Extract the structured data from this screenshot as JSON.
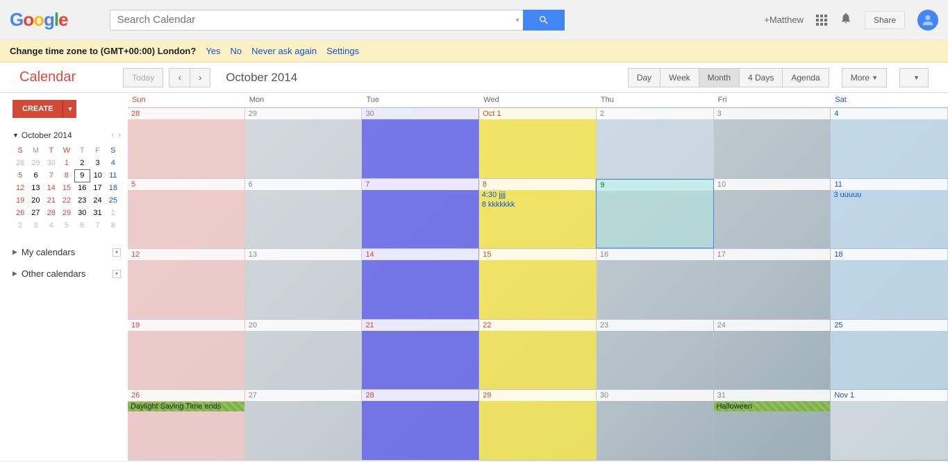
{
  "header": {
    "search_placeholder": "Search Calendar",
    "plus_user": "+Matthew",
    "share": "Share"
  },
  "tz": {
    "question": "Change time zone to (GMT+00:00) London?",
    "yes": "Yes",
    "no": "No",
    "never": "Never ask again",
    "settings": "Settings"
  },
  "toolbar": {
    "title": "Calendar",
    "today": "Today",
    "month_label": "October 2014",
    "views": {
      "day": "Day",
      "week": "Week",
      "month": "Month",
      "fourdays": "4 Days",
      "agenda": "Agenda"
    },
    "more": "More"
  },
  "sidebar": {
    "create": "CREATE",
    "mini_title": "October 2014",
    "dow": [
      "S",
      "M",
      "T",
      "W",
      "T",
      "F",
      "S"
    ],
    "weeks": [
      [
        {
          "n": "28",
          "c": "out"
        },
        {
          "n": "29",
          "c": "out"
        },
        {
          "n": "30",
          "c": "out"
        },
        {
          "n": "1",
          "c": "red"
        },
        {
          "n": "2",
          "c": ""
        },
        {
          "n": "3",
          "c": ""
        },
        {
          "n": "4",
          "c": "blue"
        }
      ],
      [
        {
          "n": "5",
          "c": "red"
        },
        {
          "n": "6",
          "c": ""
        },
        {
          "n": "7",
          "c": "red"
        },
        {
          "n": "8",
          "c": "red"
        },
        {
          "n": "9",
          "c": "today"
        },
        {
          "n": "10",
          "c": ""
        },
        {
          "n": "11",
          "c": "blue"
        }
      ],
      [
        {
          "n": "12",
          "c": "red"
        },
        {
          "n": "13",
          "c": ""
        },
        {
          "n": "14",
          "c": "red"
        },
        {
          "n": "15",
          "c": "red"
        },
        {
          "n": "16",
          "c": ""
        },
        {
          "n": "17",
          "c": ""
        },
        {
          "n": "18",
          "c": "blue"
        }
      ],
      [
        {
          "n": "19",
          "c": "red"
        },
        {
          "n": "20",
          "c": ""
        },
        {
          "n": "21",
          "c": "red"
        },
        {
          "n": "22",
          "c": "red"
        },
        {
          "n": "23",
          "c": ""
        },
        {
          "n": "24",
          "c": ""
        },
        {
          "n": "25",
          "c": "blue"
        }
      ],
      [
        {
          "n": "26",
          "c": "red"
        },
        {
          "n": "27",
          "c": ""
        },
        {
          "n": "28",
          "c": "red"
        },
        {
          "n": "29",
          "c": "red"
        },
        {
          "n": "30",
          "c": ""
        },
        {
          "n": "31",
          "c": ""
        },
        {
          "n": "1",
          "c": "out"
        }
      ],
      [
        {
          "n": "2",
          "c": "out"
        },
        {
          "n": "3",
          "c": "out"
        },
        {
          "n": "4",
          "c": "out"
        },
        {
          "n": "5",
          "c": "out"
        },
        {
          "n": "6",
          "c": "out"
        },
        {
          "n": "7",
          "c": "out"
        },
        {
          "n": "8",
          "c": "out"
        }
      ]
    ],
    "my_calendars": "My calendars",
    "other_calendars": "Other calendars"
  },
  "grid": {
    "dow": [
      "Sun",
      "Mon",
      "Tue",
      "Wed",
      "Thu",
      "Fri",
      "Sat"
    ],
    "weeks": [
      [
        {
          "n": "28",
          "bg": "bg-red"
        },
        {
          "n": "29",
          "bg": ""
        },
        {
          "n": "30",
          "bg": "bg-blue"
        },
        {
          "n": "Oct 1",
          "bg": "bg-yellow",
          "cls": "oct1"
        },
        {
          "n": "2",
          "bg": "bg-paleblue"
        },
        {
          "n": "3",
          "bg": ""
        },
        {
          "n": "4",
          "bg": "bg-ltblue",
          "cls": "blue"
        }
      ],
      [
        {
          "n": "5",
          "bg": "bg-red",
          "cls": "red"
        },
        {
          "n": "6",
          "bg": ""
        },
        {
          "n": "7",
          "bg": "bg-blue",
          "cls": "red"
        },
        {
          "n": "8",
          "bg": "bg-yellow",
          "cls": "red",
          "events": [
            {
              "t": "4:30 jjjj",
              "c": "blue"
            },
            {
              "t": "8 kkkkkkk",
              "c": "blue"
            }
          ]
        },
        {
          "n": "9",
          "bg": "bg-teal",
          "cls": "today"
        },
        {
          "n": "10",
          "bg": ""
        },
        {
          "n": "11",
          "bg": "bg-ltblue",
          "cls": "blue",
          "events": [
            {
              "t": "3 uuuuu",
              "c": "blue"
            }
          ]
        }
      ],
      [
        {
          "n": "12",
          "bg": "bg-red",
          "cls": "red"
        },
        {
          "n": "13",
          "bg": ""
        },
        {
          "n": "14",
          "bg": "bg-blue",
          "cls": "red"
        },
        {
          "n": "15",
          "bg": "bg-yellow",
          "cls": "red"
        },
        {
          "n": "16",
          "bg": ""
        },
        {
          "n": "17",
          "bg": ""
        },
        {
          "n": "18",
          "bg": "bg-ltblue",
          "cls": "blue"
        }
      ],
      [
        {
          "n": "19",
          "bg": "bg-red",
          "cls": "red"
        },
        {
          "n": "20",
          "bg": ""
        },
        {
          "n": "21",
          "bg": "bg-blue",
          "cls": "red"
        },
        {
          "n": "22",
          "bg": "bg-yellow",
          "cls": "red"
        },
        {
          "n": "23",
          "bg": ""
        },
        {
          "n": "24",
          "bg": ""
        },
        {
          "n": "25",
          "bg": "bg-ltblue",
          "cls": "blue"
        }
      ],
      [
        {
          "n": "26",
          "bg": "bg-red",
          "cls": "red",
          "events": [
            {
              "t": "Daylight Saving Time ends",
              "c": "green-bar"
            }
          ]
        },
        {
          "n": "27",
          "bg": ""
        },
        {
          "n": "28",
          "bg": "bg-blue",
          "cls": "red"
        },
        {
          "n": "29",
          "bg": "bg-yellow",
          "cls": "red"
        },
        {
          "n": "30",
          "bg": ""
        },
        {
          "n": "31",
          "bg": "",
          "events": [
            {
              "t": "Halloween",
              "c": "green-bar"
            }
          ]
        },
        {
          "n": "Nov 1",
          "bg": "bg-faint"
        }
      ]
    ]
  }
}
